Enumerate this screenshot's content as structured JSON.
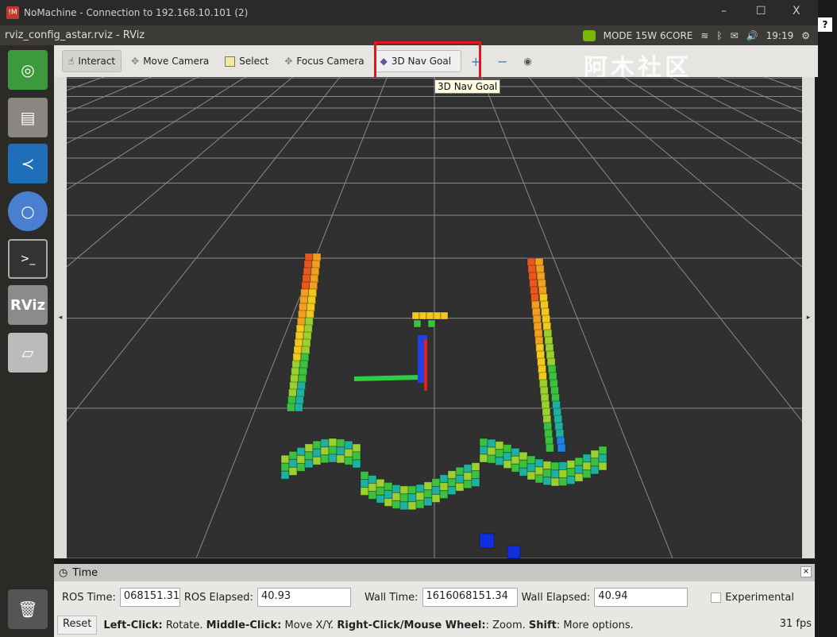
{
  "nomachine": {
    "title": "NoMachine - Connection to 192.168.10.101 (2)",
    "logo": "!M",
    "minimize": "–",
    "maximize": "☐",
    "close": "X",
    "help": "?"
  },
  "rviz": {
    "title": "rviz_config_astar.rviz - RViz",
    "tray": {
      "mode": "MODE 15W 6CORE",
      "time": "19:19"
    }
  },
  "dock": [
    {
      "name": "ubuntu-icon"
    },
    {
      "name": "files-icon"
    },
    {
      "name": "vscode-icon"
    },
    {
      "name": "chromium-icon"
    },
    {
      "name": "terminal-icon"
    },
    {
      "name": "rviz-icon",
      "label": "RViz"
    },
    {
      "name": "drive-icon"
    },
    {
      "name": "trash-icon"
    }
  ],
  "toolbar": {
    "interact": "Interact",
    "move_camera": "Move Camera",
    "select": "Select",
    "focus_camera": "Focus Camera",
    "nav_goal": "3D Nav Goal",
    "tooltip": "3D Nav Goal",
    "highlight_color": "#e0181c"
  },
  "watermark": "阿木社区",
  "time_panel": {
    "title": "Time",
    "ros_time_label": "ROS Time:",
    "ros_time": "068151.31",
    "ros_elapsed_label": "ROS Elapsed:",
    "ros_elapsed": "40.93",
    "wall_time_label": "Wall Time:",
    "wall_time": "1616068151.34",
    "wall_elapsed_label": "Wall Elapsed:",
    "wall_elapsed": "40.94",
    "experimental": "Experimental",
    "experimental_checked": false
  },
  "status": {
    "reset": "Reset",
    "lc": "Left-Click:",
    "lc_t": " Rotate.",
    "mc": "Middle-Click:",
    "mc_t": " Move X/Y.",
    "rc": "Right-Click/Mouse Wheel:",
    "rc_t": ": Zoom.",
    "sh": "Shift",
    "sh_t": ": More options.",
    "fps": "31 fps"
  }
}
